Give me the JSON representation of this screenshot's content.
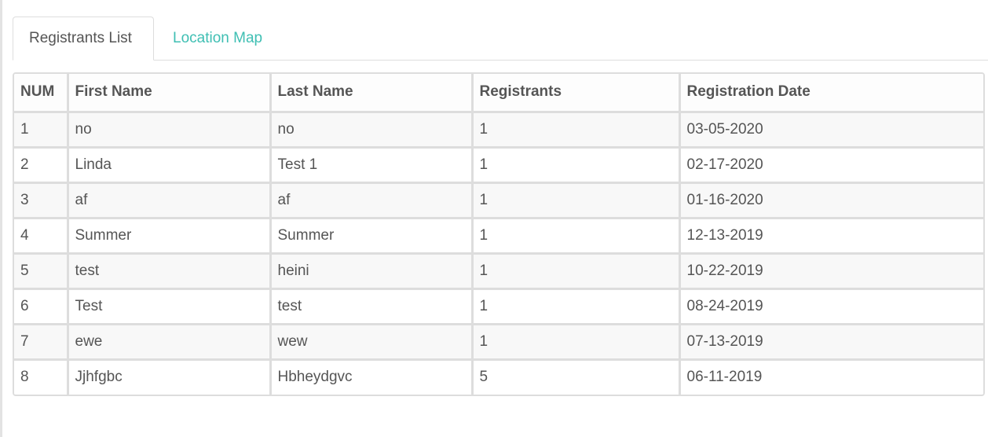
{
  "tabs": [
    {
      "label": "Registrants List",
      "active": true
    },
    {
      "label": "Location Map",
      "active": false
    }
  ],
  "colors": {
    "accent": "#3fbfb3",
    "text": "#555555",
    "border": "#dddddd",
    "stripe": "#f8f8f8"
  },
  "table": {
    "headers": [
      "NUM",
      "First Name",
      "Last Name",
      "Registrants",
      "Registration Date"
    ],
    "rows": [
      [
        "1",
        "no",
        "no",
        "1",
        "03-05-2020"
      ],
      [
        "2",
        "Linda",
        "Test 1",
        "1",
        "02-17-2020"
      ],
      [
        "3",
        "af",
        "af",
        "1",
        "01-16-2020"
      ],
      [
        "4",
        "Summer",
        "Summer",
        "1",
        "12-13-2019"
      ],
      [
        "5",
        "test",
        "heini",
        "1",
        "10-22-2019"
      ],
      [
        "6",
        "Test",
        "test",
        "1",
        "08-24-2019"
      ],
      [
        "7",
        "ewe",
        "wew",
        "1",
        "07-13-2019"
      ],
      [
        "8",
        "Jjhfgbc",
        "Hbheydgvc",
        "5",
        "06-11-2019"
      ]
    ]
  }
}
